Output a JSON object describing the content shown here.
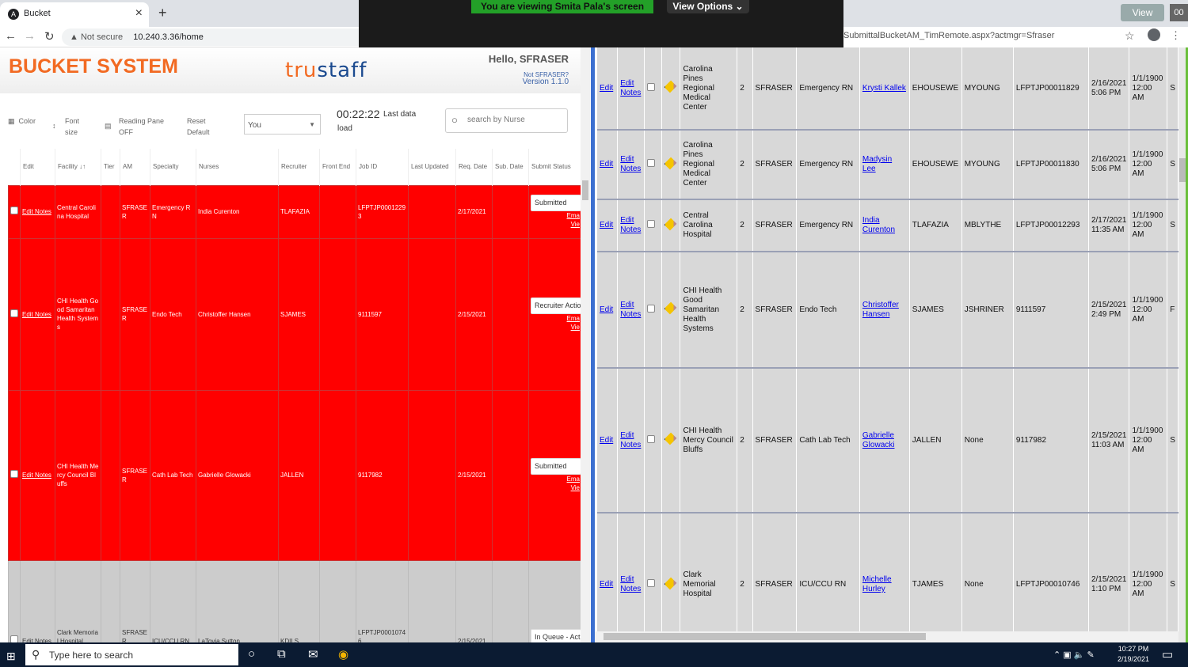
{
  "browser_left": {
    "tab_title": "Bucket",
    "tab_favicon": "A",
    "security": "Not secure",
    "url": "10.240.3.36/home"
  },
  "zoom": {
    "viewing_text": "You are viewing Smita Pala's screen",
    "view_options": "View Options"
  },
  "browser_right": {
    "url": "SubmittalBucketAM_TimRemote.aspx?actmgr=Sfraser",
    "view_button": "View",
    "corner": "00"
  },
  "app": {
    "title": "BUCKET SYSTEM",
    "logo_a": "tru",
    "logo_b": "staff",
    "hello": "Hello, SFRASER",
    "not_user": "Not SFRASER?",
    "version": "Version 1.1.0"
  },
  "toolbar": {
    "color": "Color",
    "font_size": "Font size",
    "reading_pane": "Reading Pane",
    "reading_pane_state": "OFF",
    "reset": "Reset",
    "reset_default": "Default",
    "selected": "You",
    "timer": "00:22:22",
    "last_data": "Last data",
    "load": "load",
    "search_placeholder": "search by Nurse"
  },
  "left_table": {
    "headers": [
      "",
      "Edit",
      "Facility ↓↑",
      "Tier",
      "AM",
      "Specialty",
      "Nurses",
      "Recruiter",
      "Front End",
      "Job ID",
      "Last Updated",
      "Req. Date",
      "Sub. Date",
      "Submit Status"
    ],
    "edit_label": "Edit Notes",
    "email_link": "Ema",
    "view_link": "Vie",
    "rows": [
      {
        "facility": "Central Carolina Hospital",
        "tier": "",
        "am": "SFRASER",
        "specialty": "Emergency RN",
        "nurse": "India Curenton",
        "recruiter": "TLAFAZIA",
        "front_end": "",
        "job_id": "LFPTJP00012293",
        "last_updated": "",
        "req_date": "2/17/2021",
        "sub_date": "",
        "status": "Submitted"
      },
      {
        "facility": "CHI Health Good Samaritan Health Systems",
        "tier": "",
        "am": "SFRASER",
        "specialty": "Endo Tech",
        "nurse": "Christoffer Hansen",
        "recruiter": "SJAMES",
        "front_end": "",
        "job_id": "9111597",
        "last_updated": "",
        "req_date": "2/15/2021",
        "sub_date": "",
        "status": "Recruiter Action"
      },
      {
        "facility": "CHI Health Mercy Council Bluffs",
        "tier": "",
        "am": "SFRASER",
        "specialty": "Cath Lab Tech",
        "nurse": "Gabrielle Glowacki",
        "recruiter": "JALLEN",
        "front_end": "",
        "job_id": "9117982",
        "last_updated": "",
        "req_date": "2/15/2021",
        "sub_date": "",
        "status": "Submitted"
      },
      {
        "facility": "Clark Memorial Hospital",
        "tier": "",
        "am": "SFRASER",
        "specialty": "ICU/CCU RN",
        "nurse": "LaToyia Sutton",
        "recruiter": "KDILS",
        "front_end": "",
        "job_id": "LFPTJP00010746",
        "last_updated": "",
        "req_date": "2/15/2021",
        "sub_date": "",
        "status": "In Queue - Action"
      }
    ]
  },
  "right_table": {
    "edit": "Edit",
    "edit_notes": "Edit Notes",
    "rows": [
      {
        "facility": "Carolina Pines Regional Medical Center",
        "tier": "2",
        "am": "SFRASER",
        "specialty": "Emergency RN",
        "nurse": "Krysti Kallek",
        "recruiter": "EHOUSEWE",
        "front_end": "MYOUNG",
        "job_id": "LFPTJP00011829",
        "date1": "2/16/2021 5:06 PM",
        "date2": "1/1/1900 12:00 AM",
        "extra": "S"
      },
      {
        "facility": "Carolina Pines Regional Medical Center",
        "tier": "2",
        "am": "SFRASER",
        "specialty": "Emergency RN",
        "nurse": "Madysin Lee",
        "recruiter": "EHOUSEWE",
        "front_end": "MYOUNG",
        "job_id": "LFPTJP00011830",
        "date1": "2/16/2021 5:06 PM",
        "date2": "1/1/1900 12:00 AM",
        "extra": "S"
      },
      {
        "facility": "Central Carolina Hospital",
        "tier": "2",
        "am": "SFRASER",
        "specialty": "Emergency RN",
        "nurse": "India Curenton",
        "recruiter": "TLAFAZIA",
        "front_end": "MBLYTHE",
        "job_id": "LFPTJP00012293",
        "date1": "2/17/2021 11:35 AM",
        "date2": "1/1/1900 12:00 AM",
        "extra": "S"
      },
      {
        "facility": "CHI Health Good Samaritan Health Systems",
        "tier": "2",
        "am": "SFRASER",
        "specialty": "Endo Tech",
        "nurse": "Christoffer Hansen",
        "recruiter": "SJAMES",
        "front_end": "JSHRINER",
        "job_id": "9111597",
        "date1": "2/15/2021 2:49 PM",
        "date2": "1/1/1900 12:00 AM",
        "extra": "F"
      },
      {
        "facility": "CHI Health Mercy Council Bluffs",
        "tier": "2",
        "am": "SFRASER",
        "specialty": "Cath Lab Tech",
        "nurse": "Gabrielle Glowacki",
        "recruiter": "JALLEN",
        "front_end": "None",
        "job_id": "9117982",
        "date1": "2/15/2021 11:03 AM",
        "date2": "1/1/1900 12:00 AM",
        "extra": "S"
      },
      {
        "facility": "Clark Memorial Hospital",
        "tier": "2",
        "am": "SFRASER",
        "specialty": "ICU/CCU RN",
        "nurse": "Michelle Hurley",
        "recruiter": "TJAMES",
        "front_end": "None",
        "job_id": "LFPTJP00010746",
        "date1": "2/15/2021 1:10 PM",
        "date2": "1/1/1900 12:00 AM",
        "extra": "S"
      }
    ]
  },
  "taskbar": {
    "search": "Type here to search",
    "time": "10:27 PM",
    "date": "2/19/2021"
  },
  "colors": {
    "brand": "#f26a22",
    "row_red": "#ff0000",
    "row_gray": "#cccccc",
    "divider": "#3b6fd0",
    "taskbar": "#0b1b32"
  }
}
